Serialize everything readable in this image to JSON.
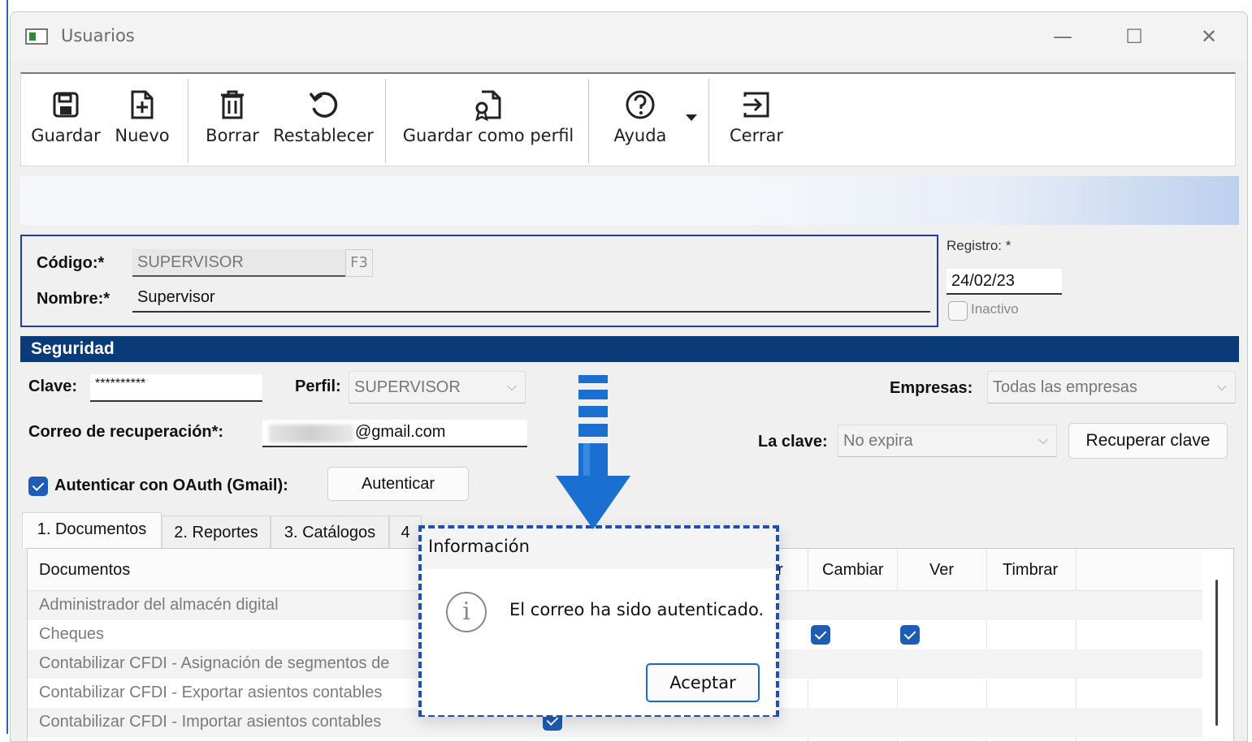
{
  "window": {
    "title": "Usuarios",
    "controls": {
      "minimize": "—",
      "maximize": "☐",
      "close": "✕"
    }
  },
  "toolbar": {
    "save": "Guardar",
    "new": "Nuevo",
    "delete": "Borrar",
    "restore": "Restablecer",
    "save_profile": "Guardar como perfil",
    "help": "Ayuda",
    "close": "Cerrar"
  },
  "identity": {
    "code_label": "Código:*",
    "code_value": "SUPERVISOR",
    "code_key": "F3",
    "name_label": "Nombre:*",
    "name_value": "Supervisor",
    "registro_label": "Registro: *",
    "registro_value": "24/02/23",
    "inactivo_label": "Inactivo"
  },
  "security": {
    "section_title": "Seguridad",
    "clave_label": "Clave:",
    "clave_value": "**********",
    "perfil_label": "Perfil:",
    "perfil_value": "SUPERVISOR",
    "empresas_label": "Empresas:",
    "empresas_value": "Todas las empresas",
    "correo_label": "Correo de recuperación*:",
    "correo_value": "@gmail.com",
    "la_clave_label": "La clave:",
    "la_clave_value": "No expira",
    "recuperar_button": "Recuperar clave",
    "oauth_label": "Autenticar con OAuth (Gmail):",
    "autenticar_button": "Autenticar"
  },
  "tabs": [
    {
      "label": "1. Documentos"
    },
    {
      "label": "2. Reportes"
    },
    {
      "label": "3. Catálogos"
    },
    {
      "label": "4"
    }
  ],
  "grid": {
    "headers": {
      "documents": "Documentos",
      "partial": "ar",
      "change": "Cambiar",
      "view": "Ver",
      "stamp": "Timbrar"
    },
    "rows": [
      {
        "name": "Administrador del almacén digital"
      },
      {
        "name": "Cheques"
      },
      {
        "name": "Contabilizar CFDI - Asignación de segmentos de"
      },
      {
        "name": "Contabilizar CFDI - Exportar asientos contables"
      },
      {
        "name": "Contabilizar CFDI - Importar asientos contables"
      }
    ]
  },
  "dialog": {
    "title": "Información",
    "message": "El correo ha sido autenticado.",
    "ok_button": "Aceptar"
  },
  "colors": {
    "accent": "#083b77",
    "dialog_border": "#1f4eb7",
    "arrow": "#1a6fd1",
    "check": "#1d5db5"
  }
}
